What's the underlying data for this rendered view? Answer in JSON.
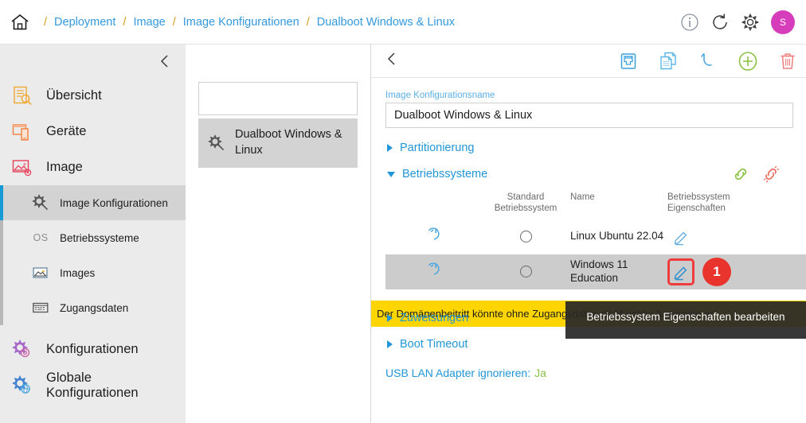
{
  "topbar": {
    "home_icon": "home-icon",
    "breadcrumbs": [
      {
        "label": "Deployment"
      },
      {
        "label": "Image"
      },
      {
        "label": "Image Konfigurationen"
      },
      {
        "label": "Dualboot Windows & Linux"
      }
    ],
    "separator": "/",
    "actions": [
      {
        "name": "info-icon",
        "icon": "info-icon"
      },
      {
        "name": "refresh-icon",
        "icon": "refresh-icon"
      },
      {
        "name": "settings-gear-icon",
        "icon": "gear-icon"
      }
    ],
    "avatar_initial": "S",
    "avatar_color": "#d63dbb"
  },
  "sidebar": {
    "collapse_icon": "chevron-left-icon",
    "items": [
      {
        "label": "Übersicht",
        "icon": "overview-icon"
      },
      {
        "label": "Geräte",
        "icon": "devices-icon"
      },
      {
        "label": "Image",
        "icon": "image-icon"
      }
    ],
    "subitems": [
      {
        "label": "Image Konfigurationen",
        "icon": "image-config-icon",
        "active": true
      },
      {
        "label": "Betriebssysteme",
        "icon": "os-icon",
        "active": false
      },
      {
        "label": "Images",
        "icon": "images-icon",
        "active": false
      },
      {
        "label": "Zugangsdaten",
        "icon": "credentials-icon",
        "active": false
      }
    ],
    "items_bottom": [
      {
        "label": "Konfigurationen",
        "icon": "configurations-icon"
      },
      {
        "label": "Globale Konfigurationen",
        "icon": "global-configurations-icon"
      }
    ]
  },
  "list_panel": {
    "search": {
      "value": "",
      "placeholder": "",
      "icon": "search-icon"
    },
    "items": [
      {
        "label": "Dualboot Windows & Linux",
        "icon": "image-config-icon",
        "selected": true
      }
    ]
  },
  "main": {
    "toolbar": {
      "back_icon": "chevron-left-icon",
      "actions": [
        {
          "name": "network-port-icon",
          "icon": "network-port-icon"
        },
        {
          "name": "duplicate-icon",
          "icon": "duplicate-icon"
        },
        {
          "name": "undo-icon",
          "icon": "undo-icon"
        },
        {
          "name": "add-icon",
          "icon": "plus-circle-icon"
        },
        {
          "name": "delete-icon",
          "icon": "trash-icon"
        }
      ]
    },
    "name_field": {
      "label": "Image Konfigurationsname",
      "value": "Dualboot Windows & Linux",
      "placeholder": ""
    },
    "sections": [
      {
        "label": "Partitionierung",
        "expanded": false
      },
      {
        "label": "Betriebssysteme",
        "expanded": true
      },
      {
        "label": "Zuweisungen",
        "expanded": false
      },
      {
        "label": "Boot Timeout",
        "expanded": false
      }
    ],
    "link_actions": [
      {
        "name": "link-icon",
        "icon": "link-icon",
        "color": "#8ac341"
      },
      {
        "name": "unlink-icon",
        "icon": "unlink-icon",
        "color": "#ef6a5a"
      }
    ],
    "table": {
      "headers": {
        "restore": "",
        "standard": "Standard Betriebssystem",
        "name": "Name",
        "properties": "Betriebssystem Eigenschaften"
      },
      "rows": [
        {
          "restore_icon": "restore-icon",
          "standard_selected": false,
          "name": "Linux Ubuntu 22.04",
          "edit_icon": "pencil-icon",
          "highlighted": false,
          "badge": null
        },
        {
          "restore_icon": "restore-icon",
          "standard_selected": false,
          "name": "Windows 11 Education",
          "edit_icon": "pencil-icon",
          "highlighted": true,
          "badge": "1"
        }
      ]
    },
    "warning": {
      "text": "Der Domänenbeitritt könnte ohne Zugangsdaten nicht richtig funktionieren",
      "color": "#ffd500"
    },
    "tooltip": {
      "text": "Betriebssystem Eigenschaften bearbeiten"
    },
    "usb_lan": {
      "key": "USB LAN Adapter ignorieren:",
      "value": "Ja"
    }
  }
}
